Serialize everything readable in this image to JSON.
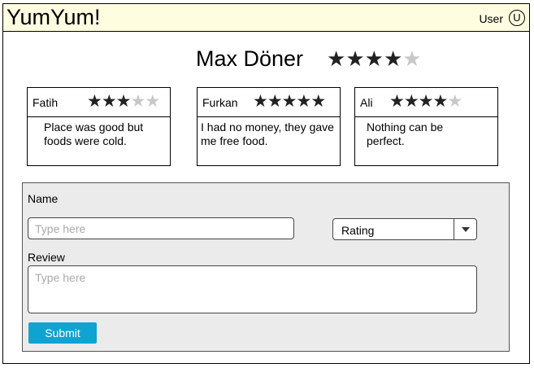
{
  "header": {
    "app_title": "YumYum!",
    "user_label": "User",
    "user_initial": "U"
  },
  "restaurant": {
    "name": "Max Döner",
    "rating": 4,
    "max_rating": 5
  },
  "reviews": [
    {
      "name": "Fatih",
      "rating": 3,
      "max_rating": 5,
      "text": "Place was good but foods were cold."
    },
    {
      "name": "Furkan",
      "rating": 5,
      "max_rating": 5,
      "text": "I had no money, they gave me free food."
    },
    {
      "name": "Ali",
      "rating": 4,
      "max_rating": 5,
      "text": "Nothing can be perfect."
    }
  ],
  "form": {
    "name_label": "Name",
    "name_placeholder": "Type here",
    "rating_select_value": "Rating",
    "review_label": "Review",
    "review_placeholder": "Type here",
    "submit_label": "Submit"
  },
  "colors": {
    "header_bg": "#fffde0",
    "submit_bg": "#0ea3d3",
    "star_filled": "#222222",
    "star_empty": "#c8c8c8"
  }
}
